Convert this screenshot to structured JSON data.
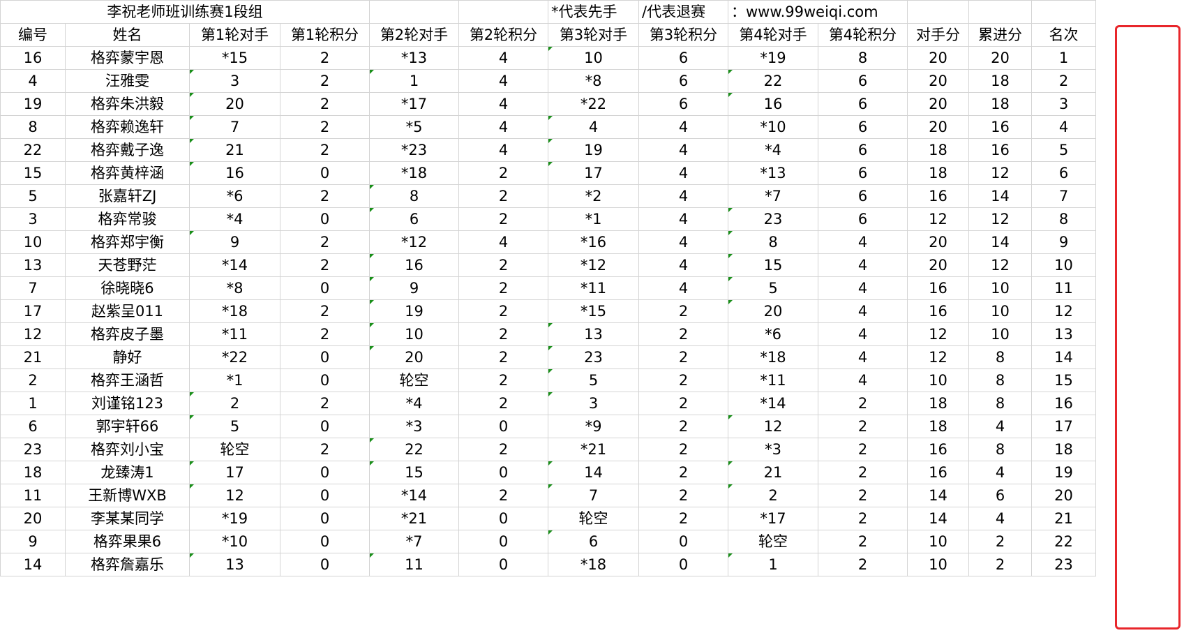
{
  "sheet": {
    "title": "李祝老师班训练赛1段组",
    "note_black": "*代表先手",
    "note_withdraw": "/代表退赛",
    "note_site": "：www.99weiqi.com",
    "headers": [
      "编号",
      "姓名",
      "第1轮对手",
      "第1轮积分",
      "第2轮对手",
      "第2轮积分",
      "第3轮对手",
      "第3轮积分",
      "第4轮对手",
      "第4轮积分",
      "对手分",
      "累进分",
      "名次"
    ],
    "rows": [
      [
        "16",
        "格弈蒙宇恩",
        "*15",
        "2",
        "*13",
        "4",
        "10",
        "6",
        "*19",
        "8",
        "20",
        "20",
        "1"
      ],
      [
        "4",
        "汪雅雯",
        "3",
        "2",
        "1",
        "4",
        "*8",
        "6",
        "22",
        "6",
        "20",
        "18",
        "2"
      ],
      [
        "19",
        "格弈朱洪毅",
        "20",
        "2",
        "*17",
        "4",
        "*22",
        "6",
        "16",
        "6",
        "20",
        "18",
        "3"
      ],
      [
        "8",
        "格弈赖逸轩",
        "7",
        "2",
        "*5",
        "4",
        "4",
        "4",
        "*10",
        "6",
        "20",
        "16",
        "4"
      ],
      [
        "22",
        "格弈戴子逸",
        "21",
        "2",
        "*23",
        "4",
        "19",
        "4",
        "*4",
        "6",
        "18",
        "16",
        "5"
      ],
      [
        "15",
        "格弈黄梓涵",
        "16",
        "0",
        "*18",
        "2",
        "17",
        "4",
        "*13",
        "6",
        "18",
        "12",
        "6"
      ],
      [
        "5",
        "张嘉轩ZJ",
        "*6",
        "2",
        "8",
        "2",
        "*2",
        "4",
        "*7",
        "6",
        "16",
        "14",
        "7"
      ],
      [
        "3",
        "格弈常骏",
        "*4",
        "0",
        "6",
        "2",
        "*1",
        "4",
        "23",
        "6",
        "12",
        "12",
        "8"
      ],
      [
        "10",
        "格弈郑宇衡",
        "9",
        "2",
        "*12",
        "4",
        "*16",
        "4",
        "8",
        "4",
        "20",
        "14",
        "9"
      ],
      [
        "13",
        "天苍野茫",
        "*14",
        "2",
        "16",
        "2",
        "*12",
        "4",
        "15",
        "4",
        "20",
        "12",
        "10"
      ],
      [
        "7",
        "徐晓晓6",
        "*8",
        "0",
        "9",
        "2",
        "*11",
        "4",
        "5",
        "4",
        "16",
        "10",
        "11"
      ],
      [
        "17",
        "赵紫呈011",
        "*18",
        "2",
        "19",
        "2",
        "*15",
        "2",
        "20",
        "4",
        "16",
        "10",
        "12"
      ],
      [
        "12",
        "格弈皮子墨",
        "*11",
        "2",
        "10",
        "2",
        "13",
        "2",
        "*6",
        "4",
        "12",
        "10",
        "13"
      ],
      [
        "21",
        "静好",
        "*22",
        "0",
        "20",
        "2",
        "23",
        "2",
        "*18",
        "4",
        "12",
        "8",
        "14"
      ],
      [
        "2",
        "格弈王涵哲",
        "*1",
        "0",
        "轮空",
        "2",
        "5",
        "2",
        "*11",
        "4",
        "10",
        "8",
        "15"
      ],
      [
        "1",
        "刘谨铭123",
        "2",
        "2",
        "*4",
        "2",
        "3",
        "2",
        "*14",
        "2",
        "18",
        "8",
        "16"
      ],
      [
        "6",
        "郭宇轩66",
        "5",
        "0",
        "*3",
        "0",
        "*9",
        "2",
        "12",
        "2",
        "18",
        "4",
        "17"
      ],
      [
        "23",
        "格弈刘小宝",
        "轮空",
        "2",
        "22",
        "2",
        "*21",
        "2",
        "*3",
        "2",
        "16",
        "8",
        "18"
      ],
      [
        "18",
        "龙臻涛1",
        "17",
        "0",
        "15",
        "0",
        "14",
        "2",
        "21",
        "2",
        "16",
        "4",
        "19"
      ],
      [
        "11",
        "王新博WXB",
        "12",
        "0",
        "*14",
        "2",
        "7",
        "2",
        "2",
        "2",
        "14",
        "6",
        "20"
      ],
      [
        "20",
        "李某某同学",
        "*19",
        "0",
        "*21",
        "0",
        "轮空",
        "2",
        "*17",
        "2",
        "14",
        "4",
        "21"
      ],
      [
        "9",
        "格弈果果6",
        "*10",
        "0",
        "*7",
        "0",
        "6",
        "0",
        "轮空",
        "2",
        "10",
        "2",
        "22"
      ],
      [
        "14",
        "格弈詹嘉乐",
        "13",
        "0",
        "11",
        "0",
        "*18",
        "0",
        "1",
        "2",
        "10",
        "2",
        "23"
      ]
    ]
  },
  "colors": {
    "highlight": "#e8262b",
    "gridline": "#d4d4d4",
    "text_marker": "#1a8f1a"
  }
}
